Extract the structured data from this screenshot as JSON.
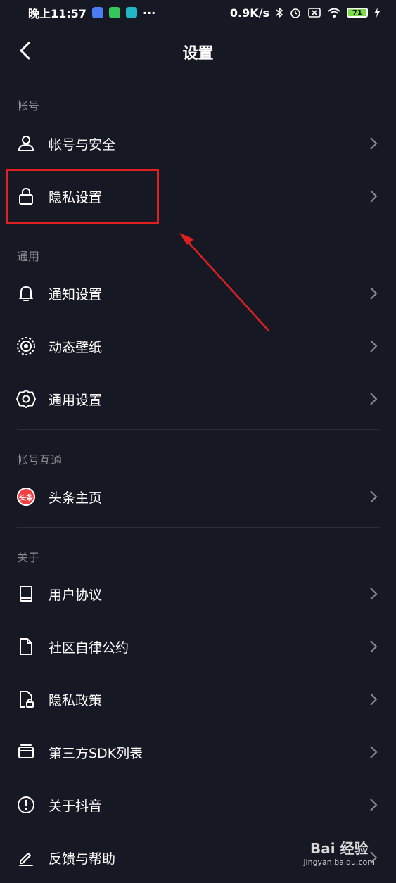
{
  "status_bar": {
    "time": "晚上11:57",
    "more": "···",
    "speed": "0.9K/s",
    "battery": "71"
  },
  "header": {
    "title": "设置"
  },
  "sections": {
    "account": {
      "title": "帐号",
      "items": [
        {
          "label": "帐号与安全",
          "icon": "user-icon"
        },
        {
          "label": "隐私设置",
          "icon": "lock-icon"
        }
      ]
    },
    "general": {
      "title": "通用",
      "items": [
        {
          "label": "通知设置",
          "icon": "bell-icon"
        },
        {
          "label": "动态壁纸",
          "icon": "wallpaper-icon"
        },
        {
          "label": "通用设置",
          "icon": "gear-icon"
        }
      ]
    },
    "interop": {
      "title": "帐号互通",
      "items": [
        {
          "label": "头条主页",
          "icon": "toutiao-icon",
          "badge": "头条"
        }
      ]
    },
    "about": {
      "title": "关于",
      "items": [
        {
          "label": "用户协议",
          "icon": "book-icon"
        },
        {
          "label": "社区自律公约",
          "icon": "document-icon"
        },
        {
          "label": "隐私政策",
          "icon": "privacy-doc-icon"
        },
        {
          "label": "第三方SDK列表",
          "icon": "card-icon"
        },
        {
          "label": "关于抖音",
          "icon": "info-icon"
        },
        {
          "label": "反馈与帮助",
          "icon": "edit-icon"
        }
      ]
    }
  },
  "watermark": {
    "text": "Bai 经验",
    "url": "jingyan.baidu.com"
  },
  "colors": {
    "background": "#161823",
    "highlight": "#e02020",
    "divider": "#2a2c36",
    "secondary_text": "#8a8b91"
  }
}
